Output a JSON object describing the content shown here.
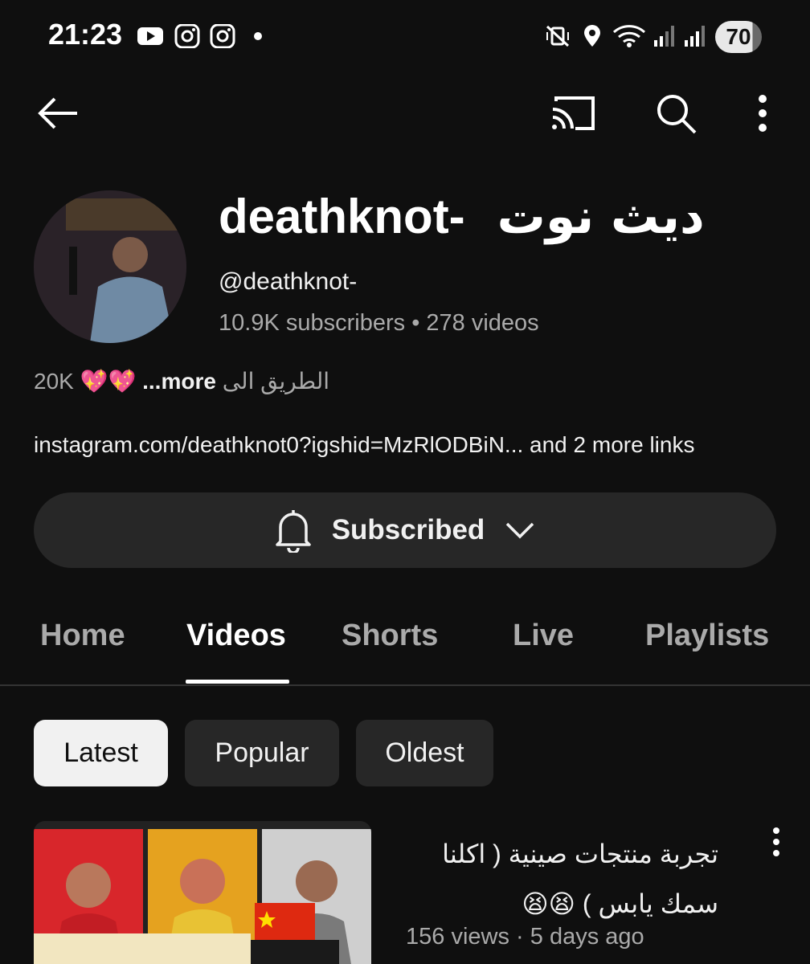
{
  "status_bar": {
    "time": "21:23",
    "battery": "70",
    "left_icons": [
      "youtube-icon",
      "instagram-icon",
      "instagram-icon",
      "dot-icon"
    ],
    "right_icons": [
      "mute-vibrate-icon",
      "location-icon",
      "wifi-icon",
      "signal-icon",
      "signal-icon"
    ]
  },
  "top_bar": {
    "icons": [
      "back-arrow-icon",
      "cast-icon",
      "search-icon",
      "more-vert-icon"
    ]
  },
  "channel": {
    "name_latin": "deathknot-",
    "name_arabic": "ديث نوت",
    "handle": "@deathknot-",
    "subscribers": "10.9K subscribers",
    "separator": "•",
    "videos": "278 videos",
    "description_prefix": "20K",
    "description_emoji": "💖💖",
    "description_more": "...more",
    "description_arabic": "الطريق الى",
    "links": "instagram.com/deathknot0?igshid=MzRlODBiN... and 2 more links"
  },
  "subscribe": {
    "label": "Subscribed",
    "icons": [
      "bell-icon",
      "chevron-down-icon"
    ]
  },
  "tabs": [
    {
      "label": "Home",
      "active": false
    },
    {
      "label": "Videos",
      "active": true
    },
    {
      "label": "Shorts",
      "active": false
    },
    {
      "label": "Live",
      "active": false
    },
    {
      "label": "Playlists",
      "active": false
    }
  ],
  "chips": [
    {
      "label": "Latest",
      "active": true
    },
    {
      "label": "Popular",
      "active": false
    },
    {
      "label": "Oldest",
      "active": false
    }
  ],
  "video": {
    "title_line1": "تجربة منتجات صينية ( اكلنا",
    "title_line2": "سمك يابس ) 😫😫",
    "views": "156 views",
    "meta_separator": "·",
    "age": "5 days ago"
  },
  "colors": {
    "background": "#0f0f0f",
    "surface": "#272727",
    "text_primary": "#f1f1f1",
    "text_secondary": "#aaaaaa"
  }
}
